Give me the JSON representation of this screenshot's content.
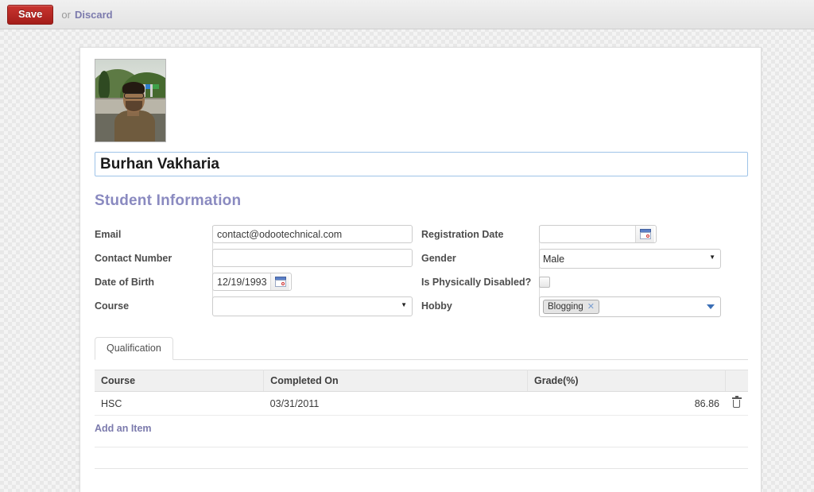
{
  "topbar": {
    "save_label": "Save",
    "or_label": "or",
    "discard_label": "Discard",
    "save_color": "#a41e1a",
    "link_color": "#7c7bad"
  },
  "record": {
    "name": "Burhan Vakharia",
    "photo_alt": "student-photo"
  },
  "section": {
    "title": "Student Information"
  },
  "form": {
    "left": [
      {
        "label": "Email",
        "value": "contact@odootechnical.com",
        "type": "text"
      },
      {
        "label": "Contact Number",
        "value": "",
        "type": "text"
      },
      {
        "label": "Date of Birth",
        "value": "12/19/1993",
        "type": "date"
      },
      {
        "label": "Course",
        "value": "",
        "type": "select"
      }
    ],
    "right": [
      {
        "label": "Registration Date",
        "value": "",
        "type": "date"
      },
      {
        "label": "Gender",
        "value": "Male",
        "type": "select"
      },
      {
        "label": "Is Physically Disabled?",
        "value": "",
        "type": "checkbox",
        "checked": false
      },
      {
        "label": "Hobby",
        "value": "Blogging",
        "type": "many2many"
      }
    ],
    "gender_options": [
      "Male"
    ],
    "course_options": [
      ""
    ],
    "hobby_tags": [
      "Blogging"
    ]
  },
  "notebook": {
    "tabs": [
      {
        "label": "Qualification",
        "active": true
      }
    ]
  },
  "qualification_table": {
    "columns": [
      "Course",
      "Completed On",
      "Grade(%)"
    ],
    "rows": [
      {
        "course": "HSC",
        "completed_on": "03/31/2011",
        "grade": "86.86"
      }
    ],
    "add_label": "Add an Item"
  },
  "icons": {
    "calendar": "calendar-icon",
    "trash": "trash-icon",
    "caret_down": "chevron-down-icon",
    "tag_remove": "close-icon"
  }
}
